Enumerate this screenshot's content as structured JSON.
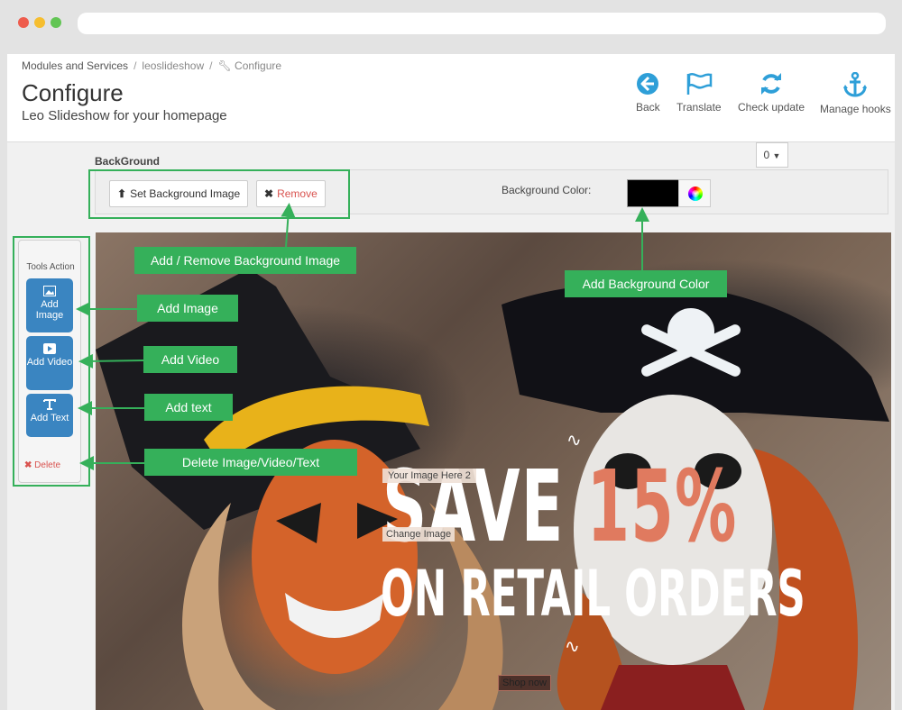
{
  "breadcrumb": {
    "item1": "Modules and Services",
    "item2": "leoslideshow",
    "item3": "Configure"
  },
  "page": {
    "title": "Configure",
    "subtitle": "Leo Slideshow for your homepage"
  },
  "toolbar": {
    "back": "Back",
    "translate": "Translate",
    "check_update": "Check update",
    "manage_hooks": "Manage hooks"
  },
  "background": {
    "label": "BackGround",
    "set_image": "Set Background Image",
    "remove": "Remove",
    "color_label": "Background Color:",
    "color_value": "#000000",
    "dropdown_value": "0"
  },
  "tools": {
    "title": "Tools Action",
    "add_image": "Add Image",
    "add_video": "Add Video",
    "add_text": "Add Text",
    "delete": "Delete"
  },
  "slide": {
    "line1_a": "SAVE ",
    "line1_b": "15%",
    "line2": "ON RETAIL ORDERS",
    "image_tag": "Your Image Here 2",
    "change_image": "Change Image",
    "shop_now": "Shop now"
  },
  "callouts": {
    "bg_image": "Add / Remove Background Image",
    "bg_color": "Add Background Color",
    "add_image": "Add Image",
    "add_video": "Add Video",
    "add_text": "Add text",
    "delete": "Delete Image/Video/Text"
  },
  "colors": {
    "accent_green": "#35b05a",
    "tool_blue": "#3a85c1",
    "icon_blue": "#2e9fd8",
    "danger": "#d9534f"
  }
}
